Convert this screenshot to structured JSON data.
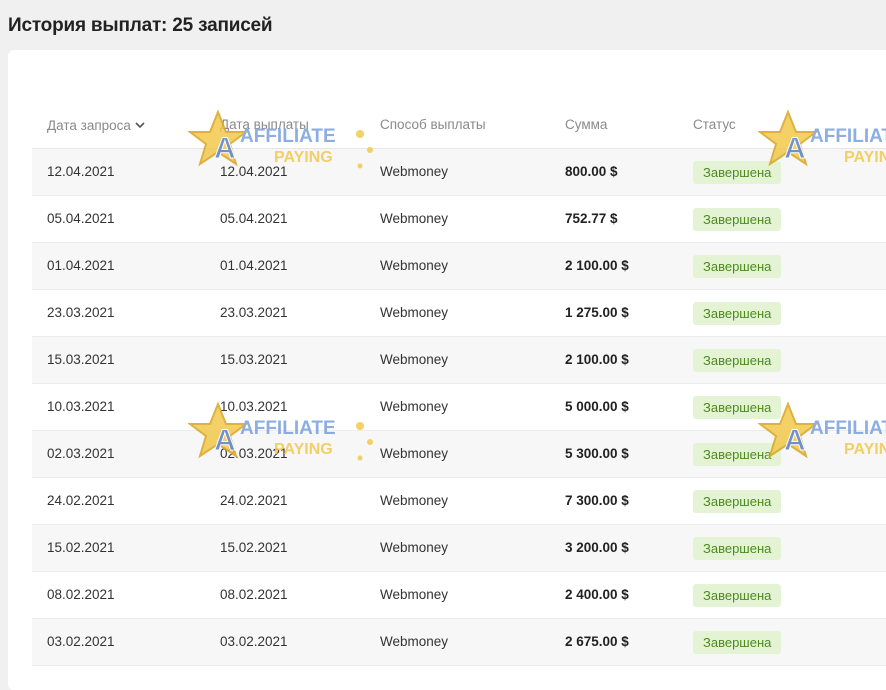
{
  "page": {
    "title": "История выплат: 25 записей"
  },
  "table": {
    "columns": [
      {
        "label": "Дата запроса",
        "sorted": true
      },
      {
        "label": "Дата выплаты"
      },
      {
        "label": "Способ выплаты"
      },
      {
        "label": "Сумма"
      },
      {
        "label": "Статус"
      }
    ],
    "rows": [
      {
        "request_date": "12.04.2021",
        "payout_date": "12.04.2021",
        "method": "Webmoney",
        "amount": "800.00 $",
        "status": "Завершена"
      },
      {
        "request_date": "05.04.2021",
        "payout_date": "05.04.2021",
        "method": "Webmoney",
        "amount": "752.77 $",
        "status": "Завершена"
      },
      {
        "request_date": "01.04.2021",
        "payout_date": "01.04.2021",
        "method": "Webmoney",
        "amount": "2 100.00 $",
        "status": "Завершена"
      },
      {
        "request_date": "23.03.2021",
        "payout_date": "23.03.2021",
        "method": "Webmoney",
        "amount": "1 275.00 $",
        "status": "Завершена"
      },
      {
        "request_date": "15.03.2021",
        "payout_date": "15.03.2021",
        "method": "Webmoney",
        "amount": "2 100.00 $",
        "status": "Завершена"
      },
      {
        "request_date": "10.03.2021",
        "payout_date": "10.03.2021",
        "method": "Webmoney",
        "amount": "5 000.00 $",
        "status": "Завершена"
      },
      {
        "request_date": "02.03.2021",
        "payout_date": "02.03.2021",
        "method": "Webmoney",
        "amount": "5 300.00 $",
        "status": "Завершена"
      },
      {
        "request_date": "24.02.2021",
        "payout_date": "24.02.2021",
        "method": "Webmoney",
        "amount": "7 300.00 $",
        "status": "Завершена"
      },
      {
        "request_date": "15.02.2021",
        "payout_date": "15.02.2021",
        "method": "Webmoney",
        "amount": "3 200.00 $",
        "status": "Завершена"
      },
      {
        "request_date": "08.02.2021",
        "payout_date": "08.02.2021",
        "method": "Webmoney",
        "amount": "2 400.00 $",
        "status": "Завершена"
      },
      {
        "request_date": "03.02.2021",
        "payout_date": "03.02.2021",
        "method": "Webmoney",
        "amount": "2 675.00 $",
        "status": "Завершена"
      }
    ]
  },
  "watermark": {
    "line1": "AFFILIATE",
    "line2": "PAYING",
    "icon": "star-logo-icon"
  },
  "colors": {
    "status_bg": "#e4f3d4",
    "status_text": "#4c8a1e",
    "page_bg": "#f0f0f0"
  }
}
